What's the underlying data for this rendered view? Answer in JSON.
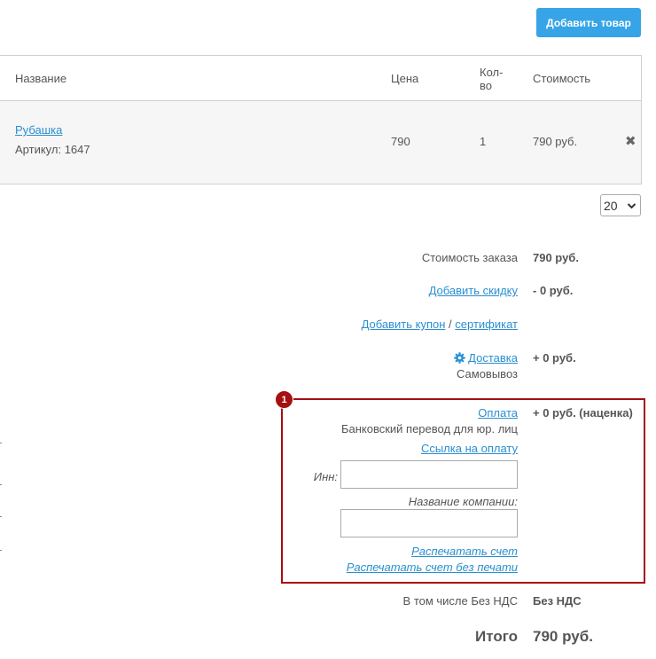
{
  "toolbar": {
    "add_button": "Добавить товар"
  },
  "table": {
    "headers": {
      "name": "Название",
      "price": "Цена",
      "qty": "Кол-во",
      "cost": "Стоимость"
    },
    "rows": [
      {
        "name": "Рубашка",
        "sku_label": "Артикул:",
        "sku": "1647",
        "price": "790",
        "qty": "1",
        "cost": "790 руб.",
        "remove_icon": "✖"
      }
    ]
  },
  "pagination": {
    "per_page": "20"
  },
  "summary": {
    "order_cost_label": "Стоимость заказа",
    "order_cost_value": "790 руб.",
    "discount_link": "Добавить скидку",
    "discount_value": "- 0 руб.",
    "coupon_link": "Добавить купон",
    "coupon_sep": " / ",
    "certificate_link": "сертификат",
    "delivery_link": "Доставка",
    "delivery_value": "+ 0 руб.",
    "delivery_method": "Самовывоз",
    "payment_link": "Оплата",
    "payment_value": "+ 0 руб. (наценка)",
    "payment_method": "Банковский перевод для юр. лиц",
    "payment_url_link": "Ссылка на оплату",
    "inn_label": "Инн:",
    "inn_value": "",
    "company_label": "Название компании:",
    "company_value": "",
    "print_invoice": "Распечатать счет",
    "print_invoice_nostamp": "Распечатать счет без печати",
    "vat_label": "В том числе Без НДС",
    "vat_value": "Без НДС",
    "total_label": "Итого",
    "total_value": "790 руб."
  },
  "annotation": {
    "badge": "1"
  },
  "colors": {
    "accent": "#36a4e6",
    "link": "#2a8fd0",
    "highlight": "#a50f12"
  }
}
